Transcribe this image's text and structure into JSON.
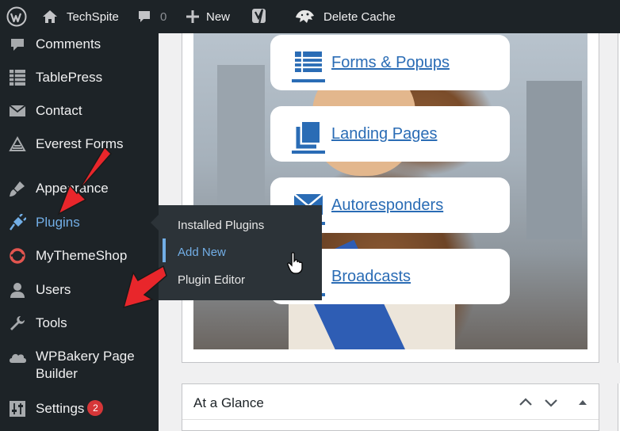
{
  "adminbar": {
    "site_name": "TechSpite",
    "comments_count": "0",
    "new_label": "New",
    "cache_label": "Delete Cache"
  },
  "sidebar": {
    "items": [
      {
        "label": "Comments",
        "icon": "comment-icon"
      },
      {
        "label": "TablePress",
        "icon": "table-icon"
      },
      {
        "label": "Contact",
        "icon": "envelope-icon"
      },
      {
        "label": "Everest Forms",
        "icon": "everest-forms-icon"
      },
      {
        "label": "Appearance",
        "icon": "paintbrush-icon"
      },
      {
        "label": "Plugins",
        "icon": "plugin-icon"
      },
      {
        "label": "MyThemeShop",
        "icon": "mythemeshop-icon"
      },
      {
        "label": "Users",
        "icon": "user-icon"
      },
      {
        "label": "Tools",
        "icon": "wrench-icon"
      },
      {
        "label": "WPBakery Page Builder",
        "icon": "cloud-icon"
      },
      {
        "label": "Settings",
        "icon": "sliders-icon",
        "badge": "2"
      }
    ]
  },
  "plugins_submenu": {
    "items": [
      {
        "label": "Installed Plugins"
      },
      {
        "label": "Add New"
      },
      {
        "label": "Plugin Editor"
      }
    ]
  },
  "promo_cards": [
    {
      "label": "Forms & Popups",
      "icon": "form-table-icon"
    },
    {
      "label": "Landing Pages",
      "icon": "pages-icon"
    },
    {
      "label": "Autoresponders",
      "icon": "envelope-icon"
    },
    {
      "label": "Broadcasts",
      "icon": "broadcast-icon"
    }
  ],
  "glance": {
    "title": "At a Glance"
  },
  "colors": {
    "admin_dark": "#1d2327",
    "flyout": "#2c3338",
    "accent": "#72aee6",
    "link_blue": "#2a6cb5",
    "badge_red": "#d63638",
    "annotation_arrow": "#e8262b"
  }
}
